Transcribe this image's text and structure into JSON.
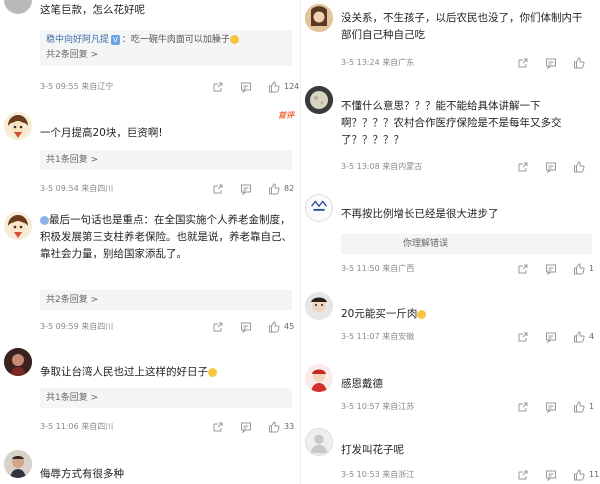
{
  "left": {
    "comments": [
      {
        "text": "这笔巨款，怎么花好呢",
        "reply": {
          "user": "稳中向好阿凡提",
          "badge": "V",
          "text": "：吃一碗牛肉面可以加臊子",
          "more": "共2条回复 >"
        },
        "date": "3-5 09:55",
        "location": "来自辽宁",
        "likes": "124"
      },
      {
        "text": "一个月提高20块，巨资啊!",
        "hot": "首评",
        "reply": {
          "more": "共1条回复 >"
        },
        "date": "3-5 09:54",
        "location": "来自四川",
        "likes": "82"
      },
      {
        "text": "最后一句话也是重点：在全国实施个人养老金制度，积极发展第三支柱养老保险。也就是说，养老靠自己、靠社会力量，别给国家添乱了。",
        "reply": {
          "more": "共2条回复 >"
        },
        "date": "3-5 09:59",
        "location": "来自四川",
        "likes": "45"
      },
      {
        "text": "争取让台湾人民也过上这样的好日子",
        "reply": {
          "more": "共1条回复 >"
        },
        "date": "3-5 11:06",
        "location": "来自四川",
        "likes": "33"
      },
      {
        "text": "侮辱方式有很多种"
      }
    ]
  },
  "right": {
    "comments": [
      {
        "text": "没关系，不生孩子，以后农民也没了，你们体制内干部们自己种自己吃",
        "date": "3-5 13:24",
        "location": "来自广东",
        "likes": ""
      },
      {
        "text": "不懂什么意思？？？能不能给具体讲解一下啊？？？？农村合作医疗保险是不是每年又多交了？？？？？",
        "date": "3-5 13:08",
        "location": "来自内蒙古",
        "likes": ""
      },
      {
        "text": "不再按比例增长已经是很大进步了",
        "reply": {
          "more": "你理解错误"
        },
        "date": "3-5 11:50",
        "location": "来自广西",
        "likes": "1"
      },
      {
        "text": "20元能买一斤肉",
        "date": "3-5 11:07",
        "location": "来自安徽",
        "likes": "4"
      },
      {
        "text": "感恩戴德",
        "date": "3-5 10:57",
        "location": "来自江苏",
        "likes": "1"
      },
      {
        "text": "打发叫花子呢",
        "date": "3-5 10:53",
        "location": "来自浙江",
        "likes": "11"
      }
    ]
  },
  "icons": {
    "share": "share-icon",
    "comment": "comment-icon",
    "like": "thumbs-up-icon"
  },
  "colors": {
    "link": "#3c6aa3",
    "hot": "#f36b3c",
    "meta": "#8a8a8a"
  }
}
